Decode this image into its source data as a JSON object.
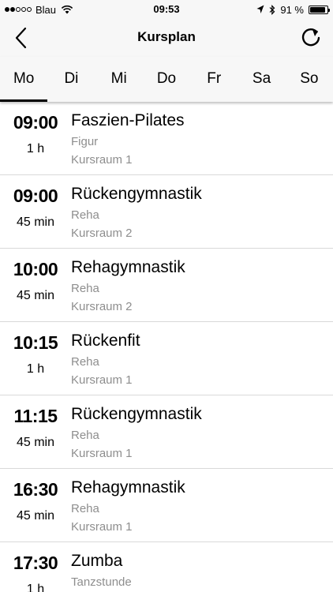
{
  "status_bar": {
    "carrier": "Blau",
    "time": "09:53",
    "battery": "91 %",
    "battery_level": 0.91
  },
  "nav": {
    "title": "Kursplan"
  },
  "days": [
    {
      "label": "Mo",
      "active": true
    },
    {
      "label": "Di",
      "active": false
    },
    {
      "label": "Mi",
      "active": false
    },
    {
      "label": "Do",
      "active": false
    },
    {
      "label": "Fr",
      "active": false
    },
    {
      "label": "Sa",
      "active": false
    },
    {
      "label": "So",
      "active": false
    }
  ],
  "courses": [
    {
      "time": "09:00",
      "duration": "1 h",
      "name": "Faszien-Pilates",
      "category": "Figur",
      "room": "Kursraum 1"
    },
    {
      "time": "09:00",
      "duration": "45 min",
      "name": "Rückengymnastik",
      "category": "Reha",
      "room": "Kursraum 2"
    },
    {
      "time": "10:00",
      "duration": "45 min",
      "name": "Rehagymnastik",
      "category": "Reha",
      "room": "Kursraum 2"
    },
    {
      "time": "10:15",
      "duration": "1 h",
      "name": "Rückenfit",
      "category": "Reha",
      "room": "Kursraum 1"
    },
    {
      "time": "11:15",
      "duration": "45 min",
      "name": "Rückengymnastik",
      "category": "Reha",
      "room": "Kursraum 1"
    },
    {
      "time": "16:30",
      "duration": "45 min",
      "name": "Rehagymnastik",
      "category": "Reha",
      "room": "Kursraum 1"
    },
    {
      "time": "17:30",
      "duration": "1 h",
      "name": "Zumba",
      "category": "Tanzstunde",
      "room": ""
    }
  ]
}
